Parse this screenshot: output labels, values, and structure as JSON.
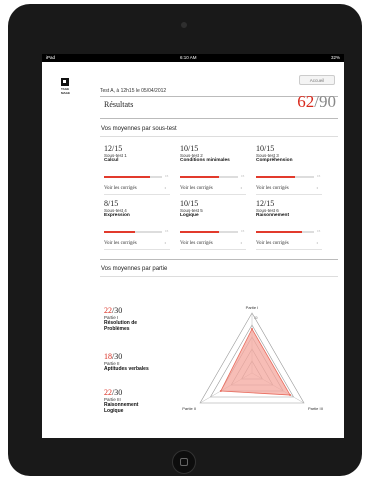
{
  "status": {
    "carrier": "iPad",
    "time": "6:10 AM",
    "battery": "32%"
  },
  "logo": {
    "text": "TAGE\nMAGE"
  },
  "header": {
    "test_line": "Test A, à 12h15 le 05/04/2012",
    "home_label": "Accueil"
  },
  "results": {
    "title": "Résultats",
    "score": "62",
    "total": "/90"
  },
  "subtests_heading": "Vos moyennes par sous-test",
  "subtests": [
    {
      "score": "12/15",
      "subtitle": "Sous-test 1",
      "name": "Calcul",
      "fill_fraction": 0.8,
      "bar_max": "15",
      "link": "Voir les corrigés"
    },
    {
      "score": "10/15",
      "subtitle": "Sous-test 2",
      "name": "Conditions minimales",
      "fill_fraction": 0.67,
      "bar_max": "15",
      "link": "Voir les corrigés"
    },
    {
      "score": "10/15",
      "subtitle": "Sous-test 3",
      "name": "Compréhension",
      "fill_fraction": 0.67,
      "bar_max": "15",
      "link": "Voir les corrigés"
    },
    {
      "score": "8/15",
      "subtitle": "Sous-test 4",
      "name": "Expression",
      "fill_fraction": 0.53,
      "bar_max": "15",
      "link": "Voir les corrigés"
    },
    {
      "score": "10/15",
      "subtitle": "Sous-test 5",
      "name": "Logique",
      "fill_fraction": 0.67,
      "bar_max": "15",
      "link": "Voir les corrigés"
    },
    {
      "score": "12/15",
      "subtitle": "Sous-test 6",
      "name": "Raisonnement",
      "fill_fraction": 0.8,
      "bar_max": "15",
      "link": "Voir les corrigés"
    }
  ],
  "parts_heading": "Vos moyennes par partie",
  "parts": [
    {
      "score": "22",
      "total": "/30",
      "label": "Partie I",
      "name": "Résolution de Problèmes"
    },
    {
      "score": "18",
      "total": "/30",
      "label": "Partie II",
      "name": "Aptitudes verbales"
    },
    {
      "score": "22",
      "total": "/30",
      "label": "Partie III",
      "name": "Raisonnement Logique"
    }
  ],
  "radar": {
    "axes": [
      "Partie I",
      "Partie II",
      "Partie III"
    ],
    "max": 30,
    "scale_label": "30",
    "values": [
      22,
      18,
      22
    ],
    "fill_color": "#f4a79e",
    "stroke_color": "#e86a5c"
  },
  "chevron": "›",
  "colors": {
    "accent": "#d9291c"
  }
}
